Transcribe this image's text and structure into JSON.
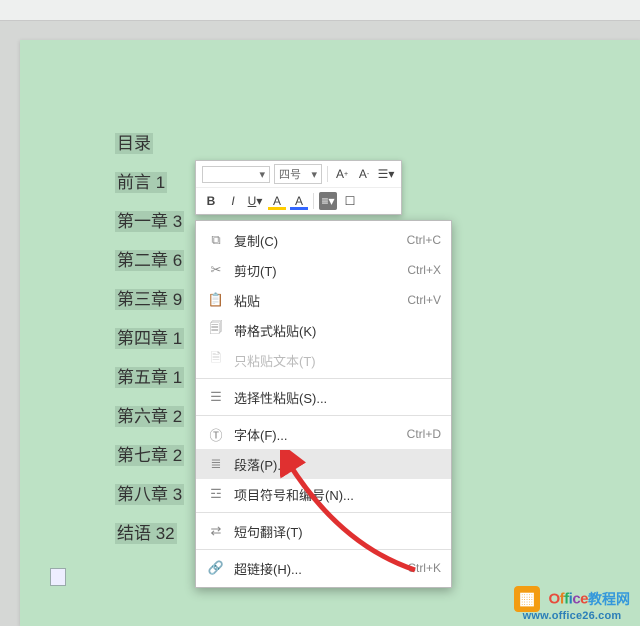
{
  "toc": {
    "title": "目录",
    "lines": [
      "前言 1",
      "第一章 3",
      "第二章 6",
      "第三章 9",
      "第四章 1",
      "第五章 1",
      "第六章 2",
      "第七章 2",
      "第八章 3",
      "结语 32"
    ]
  },
  "minitoolbar": {
    "font_dropdown": "",
    "size_dropdown": "四号"
  },
  "context_menu": {
    "items": [
      {
        "label": "复制(C)",
        "shortcut": "Ctrl+C"
      },
      {
        "label": "剪切(T)",
        "shortcut": "Ctrl+X"
      },
      {
        "label": "粘贴",
        "shortcut": "Ctrl+V"
      },
      {
        "label": "带格式粘贴(K)",
        "shortcut": ""
      },
      {
        "label": "只粘贴文本(T)",
        "shortcut": ""
      },
      {
        "label": "选择性粘贴(S)...",
        "shortcut": ""
      },
      {
        "label": "字体(F)...",
        "shortcut": "Ctrl+D"
      },
      {
        "label": "段落(P)...",
        "shortcut": ""
      },
      {
        "label": "项目符号和编号(N)...",
        "shortcut": ""
      },
      {
        "label": "短句翻译(T)",
        "shortcut": ""
      },
      {
        "label": "超链接(H)...",
        "shortcut": "Ctrl+K"
      }
    ]
  },
  "watermark": {
    "line1": "Office",
    "cn": "教程网",
    "url": "www.office26.com"
  }
}
